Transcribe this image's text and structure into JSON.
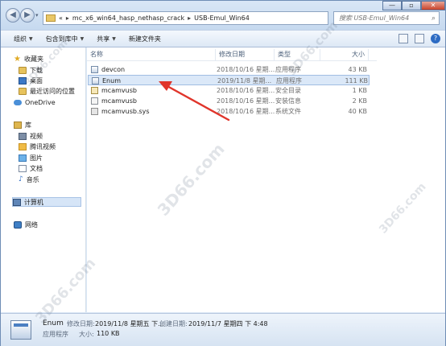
{
  "window": {
    "controls": {
      "minimize": "—",
      "maximize": "▫",
      "close": "✕"
    }
  },
  "address": {
    "crumbs": [
      "mc_x6_win64_hasp_nethasp_crack",
      "USB-Emul_Win64"
    ],
    "overflow": "«",
    "separator": "▸"
  },
  "search": {
    "placeholder": "搜索 USB-Emul_Win64"
  },
  "toolbar": {
    "organize": "组织",
    "include_in_library": "包含到库中",
    "share": "共享",
    "new_folder": "新建文件夹"
  },
  "sidebar": {
    "favorites": {
      "label": "收藏夹",
      "items": [
        "下载",
        "桌面",
        "最近访问的位置"
      ]
    },
    "onedrive": "OneDrive",
    "library": {
      "label": "库",
      "items": [
        "视频",
        "腾讯视频",
        "图片",
        "文档",
        "音乐"
      ]
    },
    "computer": "计算机",
    "network": "网络"
  },
  "columns": {
    "name": "名称",
    "date": "修改日期",
    "type": "类型",
    "size": "大小"
  },
  "files": [
    {
      "name": "devcon",
      "date": "2018/10/16 星期...",
      "type": "应用程序",
      "size": "43 KB",
      "kind": "exe"
    },
    {
      "name": "Enum",
      "date": "2019/11/8 星期...",
      "type": "应用程序",
      "size": "111 KB",
      "kind": "exe"
    },
    {
      "name": "mcamvusb",
      "date": "2018/10/16 星期...",
      "type": "安全目录",
      "size": "1 KB",
      "kind": "cat"
    },
    {
      "name": "mcamvusb",
      "date": "2018/10/16 星期...",
      "type": "安装信息",
      "size": "2 KB",
      "kind": "inf"
    },
    {
      "name": "mcamvusb.sys",
      "date": "2018/10/16 星期...",
      "type": "系统文件",
      "size": "40 KB",
      "kind": "sys"
    }
  ],
  "details": {
    "name": "Enum",
    "type": "应用程序",
    "modified_label": "修改日期:",
    "modified_value": "2019/11/8 星期五 下...",
    "created_label": "创建日期:",
    "created_value": "2019/11/7 星期四 下 4:48",
    "size_label": "大小:",
    "size_value": "110 KB"
  },
  "watermarks": [
    "3D66.com",
    "3D66.com",
    "3D66.com",
    "3D66.com",
    "3D66.com"
  ],
  "accent": {
    "selection": "#dbe8f8",
    "arrow": "#e0352b"
  }
}
